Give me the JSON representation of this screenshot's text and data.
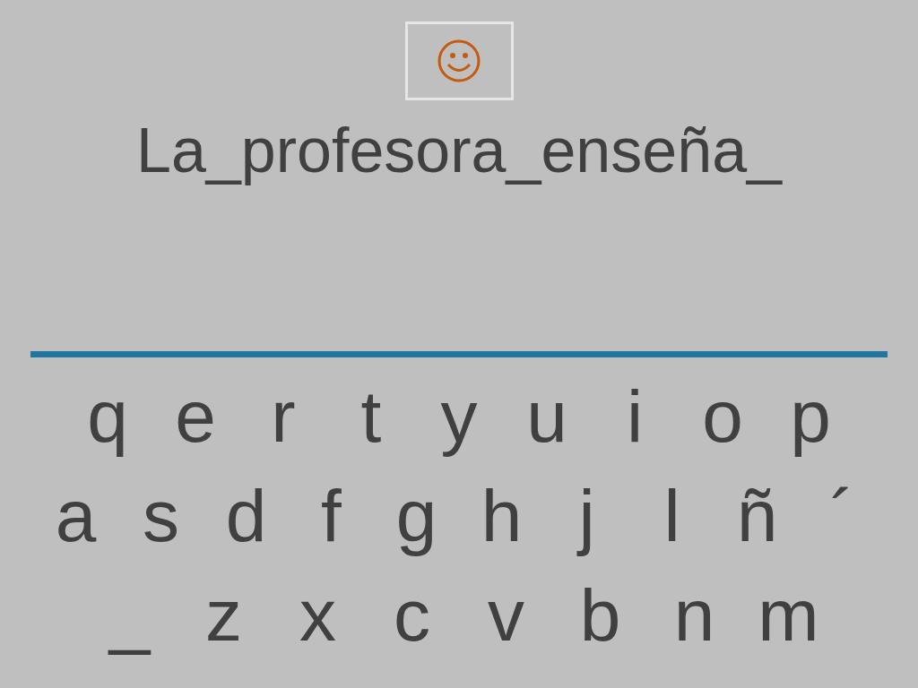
{
  "sentence": "La_profesora_enseña_",
  "keyboard_rows": [
    [
      "q",
      "e",
      "r",
      "t",
      "y",
      "u",
      "i",
      "o",
      "p"
    ],
    [
      "a",
      "s",
      "d",
      "f",
      "g",
      "h",
      "j",
      "l",
      "ñ",
      "´"
    ],
    [
      "_",
      "z",
      "x",
      "c",
      "v",
      "b",
      "n",
      "m"
    ]
  ]
}
